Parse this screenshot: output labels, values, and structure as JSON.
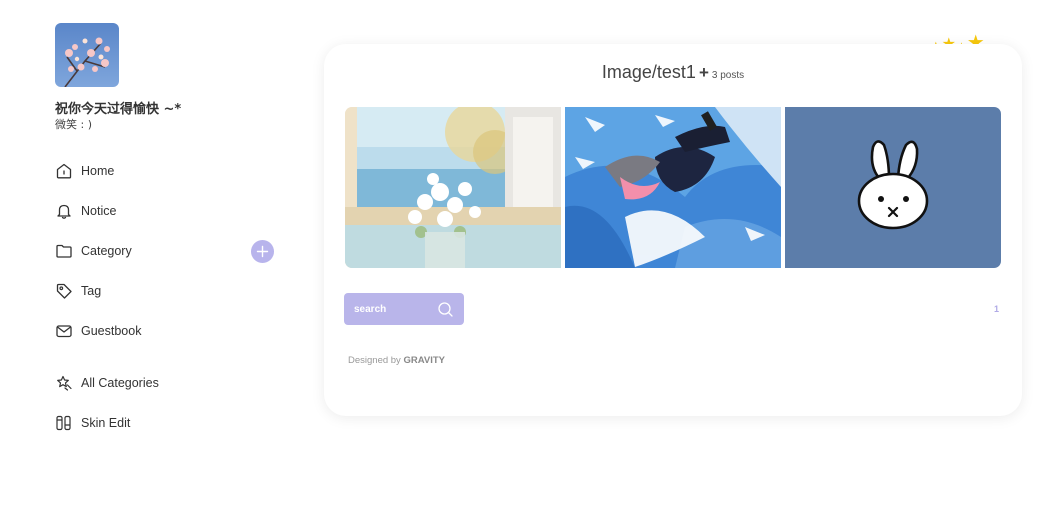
{
  "profile": {
    "title": "祝你今天过得愉快 ~*",
    "subtitle": "微笑 : )"
  },
  "nav": {
    "home": "Home",
    "notice": "Notice",
    "category": "Category",
    "tag": "Tag",
    "guestbook": "Guestbook",
    "all_categories": "All Categories",
    "skin_edit": "Skin Edit"
  },
  "icons": {
    "home": "home-icon",
    "notice": "bell-icon",
    "category": "folder-icon",
    "tag": "tag-icon",
    "guestbook": "mail-icon",
    "all_categories": "stars-icon",
    "skin_edit": "brush-icon",
    "add": "plus-icon",
    "search": "search-icon"
  },
  "decoration": {
    "stars": [
      "★",
      "★",
      "★",
      "★"
    ]
  },
  "card": {
    "title": "Image/test1",
    "plus": "+",
    "count": "3 posts"
  },
  "search": {
    "placeholder": "search"
  },
  "pagination": {
    "current": "1"
  },
  "footer": {
    "designed_by": "Designed by",
    "brand": "GRAVITY"
  },
  "colors": {
    "accent": "#b9b5ea",
    "star": "#f7c80e",
    "thumb3_bg": "#5c7daa"
  }
}
